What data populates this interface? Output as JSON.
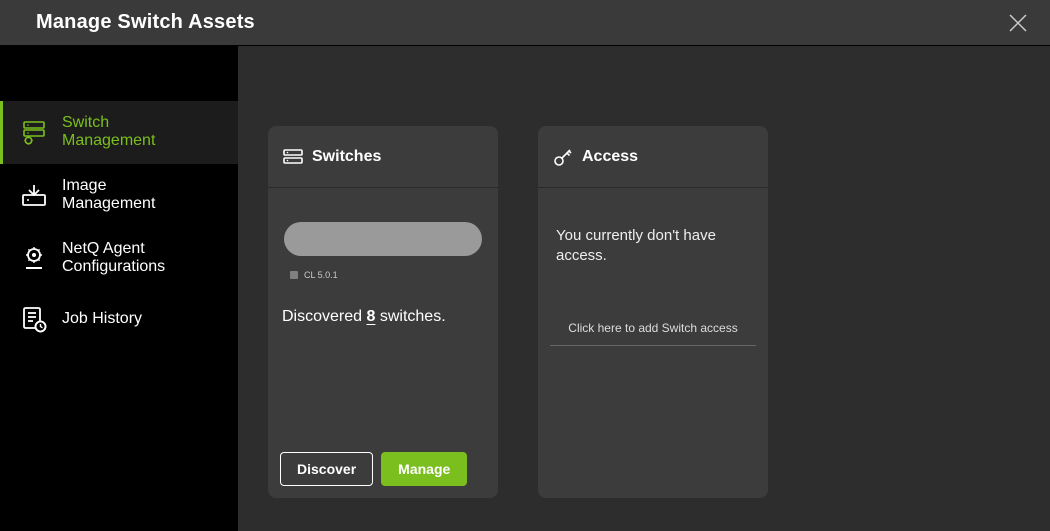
{
  "title": "Manage Switch Assets",
  "colors": {
    "accent": "#7bbf1e",
    "panel": "#3c3c3c",
    "bg": "#2d2d2d",
    "sidebar_bg": "#000000"
  },
  "sidebar": {
    "items": [
      {
        "label": "Switch\nManagement",
        "icon": "switch-management-icon",
        "active": true
      },
      {
        "label": "Image\nManagement",
        "icon": "image-management-icon",
        "active": false
      },
      {
        "label": "NetQ Agent\nConfigurations",
        "icon": "netq-agent-icon",
        "active": false
      },
      {
        "label": "Job History",
        "icon": "job-history-icon",
        "active": false
      }
    ]
  },
  "cards": {
    "switches": {
      "title": "Switches",
      "versions": [
        {
          "label": "CL 5.0.1"
        }
      ],
      "discovered_prefix": "Discovered ",
      "discovered_count": "8",
      "discovered_suffix": " switches.",
      "buttons": {
        "discover": "Discover",
        "manage": "Manage"
      }
    },
    "access": {
      "title": "Access",
      "message": "You currently don't have access.",
      "link_label": "Click here to add Switch access"
    }
  }
}
